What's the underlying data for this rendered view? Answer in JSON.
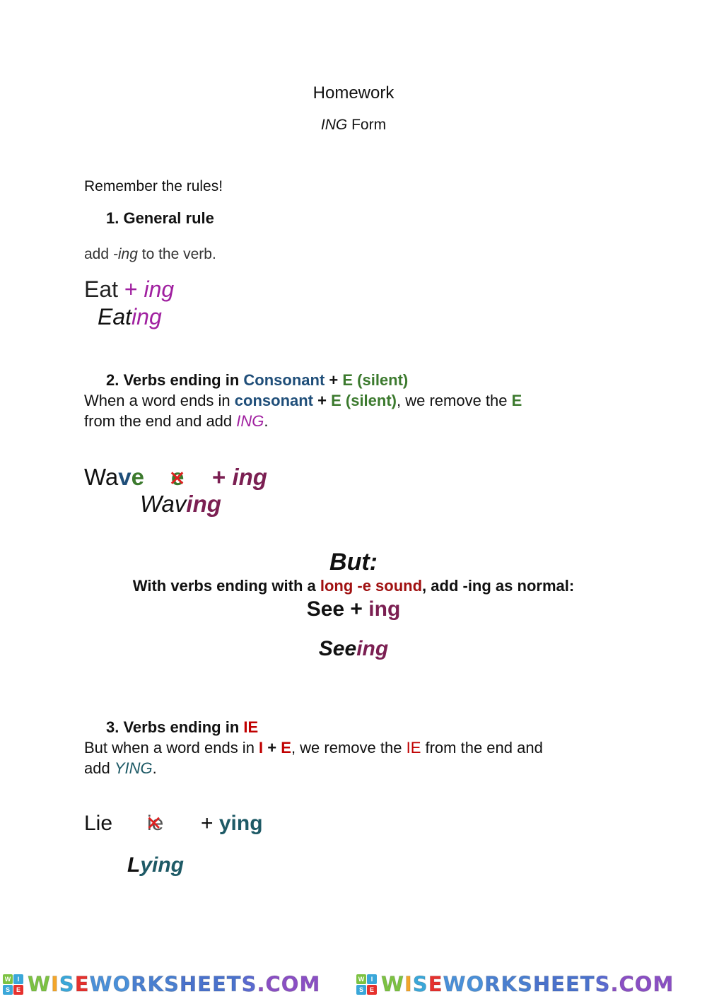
{
  "header": {
    "title": "Homework",
    "subtitle_italic": "ING",
    "subtitle_rest": " Form"
  },
  "intro": "Remember the rules!",
  "rule1": {
    "heading": "1. General rule",
    "text_before": "add ",
    "text_italic": "-ing",
    "text_after": " to the verb.",
    "example_base": "Eat",
    "example_plus": " + ",
    "example_suffix": "ing",
    "result_base": "Eat",
    "result_suffix": "ing"
  },
  "rule2": {
    "heading_prefix": "2. Verbs ending in ",
    "heading_consonant": "Consonant",
    "heading_plus": " + ",
    "heading_e": "E (silent)",
    "line1_prefix": "When a word ends in ",
    "line1_consonant": "consonant",
    "line1_plus": " + ",
    "line1_e": "E (silent)",
    "line1_mid": ", we remove the ",
    "line1_E": "E",
    "line2_prefix": "from the end and add ",
    "line2_ing": "ING",
    "line2_end": ".",
    "example_wa": "Wa",
    "example_v": "v",
    "example_e": "e",
    "removed_letter": "e",
    "cross_mark": "✕",
    "example_plus": "+ ",
    "example_suffix": "ing",
    "result_base": "Wav",
    "result_suffix": "ing"
  },
  "exception": {
    "heading": "But:",
    "line_prefix": "With verbs ending with a ",
    "line_highlight": "long -e sound",
    "line_suffix": ", add -ing as normal:",
    "example_base": "See + ",
    "example_suffix": "ing",
    "result_base": "See",
    "result_suffix": "ing"
  },
  "rule3": {
    "heading_prefix": "3. Verbs ending in ",
    "heading_ie": "IE",
    "line1_prefix": "But when a word ends in ",
    "line1_i": "I",
    "line1_plus": " + ",
    "line1_e": "E",
    "line1_mid": ", we remove the ",
    "line1_ie": "IE",
    "line1_end": " from the end and",
    "line2_prefix": "add ",
    "line2_ying": "YING",
    "line2_end": ".",
    "example_base": "Lie",
    "removed_letters": "ie",
    "cross_mark": "✕",
    "example_plus": "+ ",
    "example_suffix": "ying",
    "result_base": "L",
    "result_suffix": "ying"
  },
  "footer": {
    "logo_box_letters": [
      "W",
      "I",
      "S",
      "E"
    ],
    "logo_letters": [
      "W",
      "I",
      "S",
      "E",
      "W",
      "O",
      "R",
      "K",
      "S",
      "H",
      "E",
      "E",
      "T",
      "S",
      ".",
      "C",
      "O",
      "M"
    ],
    "logo_colors": [
      "#7cc242",
      "#f4a62a",
      "#3aa7d9",
      "#e6312e",
      "#4a90d9",
      "#4a90d9",
      "#4a7fd0",
      "#4a7fd0",
      "#4a7fd0",
      "#4a72cc",
      "#4a72cc",
      "#4a72cc",
      "#4a72cc",
      "#5a6ad0",
      "#8a4fc4",
      "#8a4fc4",
      "#8a4fc4",
      "#8a4fc4"
    ],
    "logo_box_colors": [
      "#7cc242",
      "#3aa7d9",
      "#3aa7d9",
      "#e6312e"
    ]
  }
}
